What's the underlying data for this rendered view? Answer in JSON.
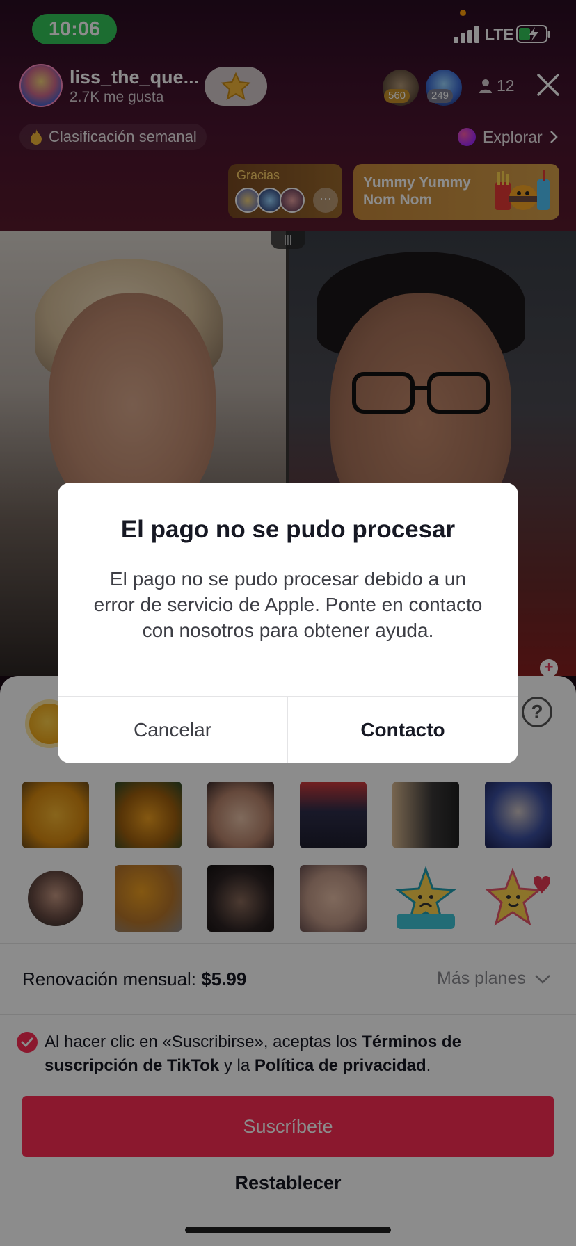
{
  "status_bar": {
    "time": "10:06",
    "network": "LTE"
  },
  "host": {
    "name": "liss_the_que...",
    "likes": "2.7K me gusta"
  },
  "top_viewers": [
    {
      "badge": "560"
    },
    {
      "badge": "249"
    }
  ],
  "viewer_count": "12",
  "weekly_ranking": "Clasificación semanal",
  "explore": "Explorar",
  "thanks_card": {
    "label": "Gracias",
    "more": "···"
  },
  "promo_card": {
    "title": "Yummy Yummy Nom Nom"
  },
  "video": {
    "divider_label": "|||"
  },
  "sheet": {
    "help": "?",
    "renewal_label": "Renovación mensual:",
    "renewal_price": "$5.99",
    "more_plans": "Más planes",
    "terms": {
      "part1": "Al hacer clic en «Suscribirse», aceptas los ",
      "link1": "Términos de suscripción de TikTok",
      "part2": " y la ",
      "link2": "Política de privacidad",
      "part3": "."
    },
    "subscribe_label": "Suscríbete",
    "restore_label": "Restablecer"
  },
  "alert": {
    "title": "El pago no se pudo procesar",
    "message": "El pago no se pudo procesar debido a un error de servicio de Apple. Ponte en contacto con nosotros para obtener ayuda.",
    "cancel_label": "Cancelar",
    "contact_label": "Contacto"
  },
  "colors": {
    "accent": "#fe2c55",
    "status_green": "#34c759",
    "promo_gold": "#d7a04a"
  },
  "icons": [
    "signal-icon",
    "battery-charging-icon",
    "star-icon",
    "person-icon",
    "close-icon",
    "flame-icon",
    "chevron-right-icon",
    "chevron-down-icon",
    "question-icon",
    "check-icon",
    "plus-icon"
  ]
}
